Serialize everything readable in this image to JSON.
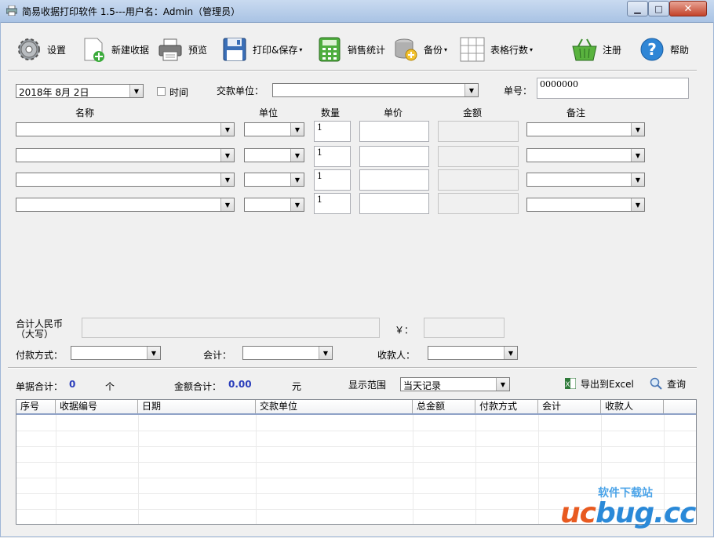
{
  "window": {
    "title": "简易收据打印软件 1.5---用户名：Admin（管理员）",
    "min_glyph": "▁",
    "max_glyph": "□",
    "close_glyph": "✕"
  },
  "toolbar": {
    "settings": "设置",
    "new_receipt": "新建收据",
    "preview": "预览",
    "print_save": "打印&保存",
    "sales_stats": "销售统计",
    "backup": "备份",
    "table_rows": "表格行数",
    "register": "注册",
    "help": "帮助",
    "arrow": "▾"
  },
  "form": {
    "date_value": "2018年  8月  2日",
    "time_label": "时间",
    "partner_label": "交款单位：",
    "partner_value": "",
    "number_label": "单号：",
    "number_value": "0000000",
    "headers": {
      "name": "名称",
      "unit": "单位",
      "qty": "数量",
      "price": "单价",
      "amount": "金额",
      "note": "备注"
    },
    "rows": [
      {
        "qty": "1"
      },
      {
        "qty": "1"
      },
      {
        "qty": "1"
      },
      {
        "qty": "1"
      }
    ],
    "total_rmb_label_1": "合计人民币",
    "total_rmb_label_2": "（大写）",
    "yen_label": "￥：",
    "payment_label": "付款方式：",
    "accountant_label": "会计：",
    "payee_label": "收款人："
  },
  "summary": {
    "receipt_count_label": "单据合计：",
    "receipt_count": "0",
    "receipt_unit": "个",
    "amount_total_label": "金额合计：",
    "amount_total": "0.00",
    "amount_unit": "元",
    "range_label": "显示范围",
    "range_value": "当天记录",
    "export_label": "导出到Excel",
    "query_label": "查询"
  },
  "grid": {
    "columns": [
      "序号",
      "收据编号",
      "日期",
      "交款单位",
      "总金额",
      "付款方式",
      "会计",
      "收款人"
    ]
  },
  "watermark": {
    "small": "软件下载站",
    "big_u": "uc",
    "big_c": "bug",
    "big_tail": ".cc"
  }
}
